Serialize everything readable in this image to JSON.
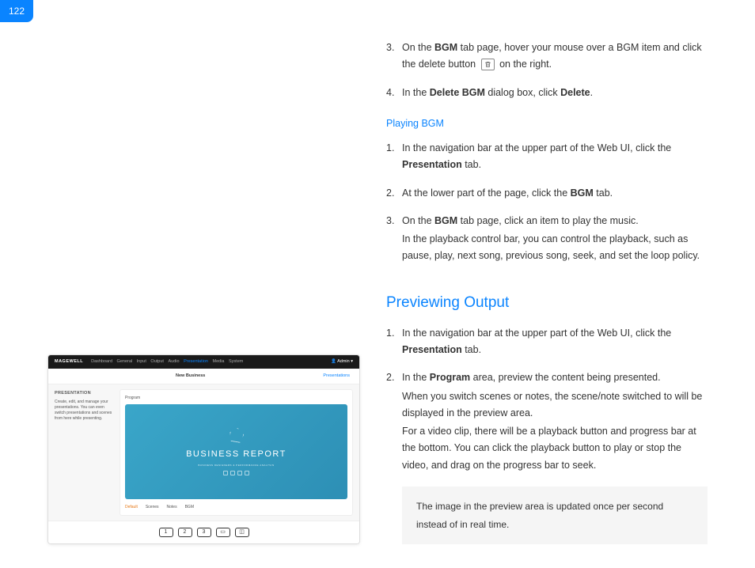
{
  "page_number": "122",
  "list1": {
    "items": [
      {
        "num": "3.",
        "p1a": "On the ",
        "p1b": "BGM",
        "p1c": " tab page, hover your mouse over a BGM item and click the delete button ",
        "p1d": " on the right."
      },
      {
        "num": "4.",
        "p1a": "In the ",
        "p1b": "Delete BGM",
        "p1c": " dialog box, click ",
        "p1d": "Delete",
        "p1e": "."
      }
    ]
  },
  "section1_title": "Playing BGM",
  "list2": {
    "items": [
      {
        "num": "1.",
        "p1a": "In the navigation bar at the upper part of the Web UI, click the ",
        "p1b": "Presentation",
        "p1c": " tab."
      },
      {
        "num": "2.",
        "p1a": "At the lower part of the page, click the ",
        "p1b": "BGM",
        "p1c": " tab."
      },
      {
        "num": "3.",
        "p1a": "On the ",
        "p1b": "BGM",
        "p1c": " tab page, click an item to play the music.",
        "p2": "In the playback control bar, you can control the playback, such as pause, play, next song, previous song, seek, and set the loop policy."
      }
    ]
  },
  "section2_heading": "Previewing Output",
  "list3": {
    "items": [
      {
        "num": "1.",
        "p1a": "In the navigation bar at the upper part of the Web UI, click the ",
        "p1b": "Presentation",
        "p1c": " tab."
      },
      {
        "num": "2.",
        "p1a": "In the ",
        "p1b": "Program",
        "p1c": " area, preview the content being presented.",
        "p2": "When you switch scenes or notes, the scene/note switched to will be displayed in the preview area.",
        "p3": "For a video clip, there will be a playback button and progress bar at the bottom. You can click the playback button to play or stop the video, and drag on the progress bar to seek."
      }
    ]
  },
  "note": "The image in the preview area is updated once per second instead of in real time.",
  "mock": {
    "logo": "MAGEWELL",
    "nav": [
      "Dashboard",
      "General",
      "Input",
      "Output",
      "Audio",
      "Presentation",
      "Media",
      "System"
    ],
    "admin": "Admin",
    "sub_title": "New Business",
    "sub_link": "Presentations",
    "side_title": "PRESENTATION",
    "side_text": "Create, edit, and manage your presentations. You can even switch presentations and scenes from here while presenting.",
    "program_label": "Program",
    "preview_title": "BUSINESS REPORT",
    "preview_sub": "BUSINESS DESIGNERS & PERFORMANCE ANALYSIS",
    "tabs": [
      "Default",
      "Scenes",
      "Notes",
      "BGM"
    ],
    "footer_buttons": [
      "1",
      "2",
      "3"
    ]
  }
}
